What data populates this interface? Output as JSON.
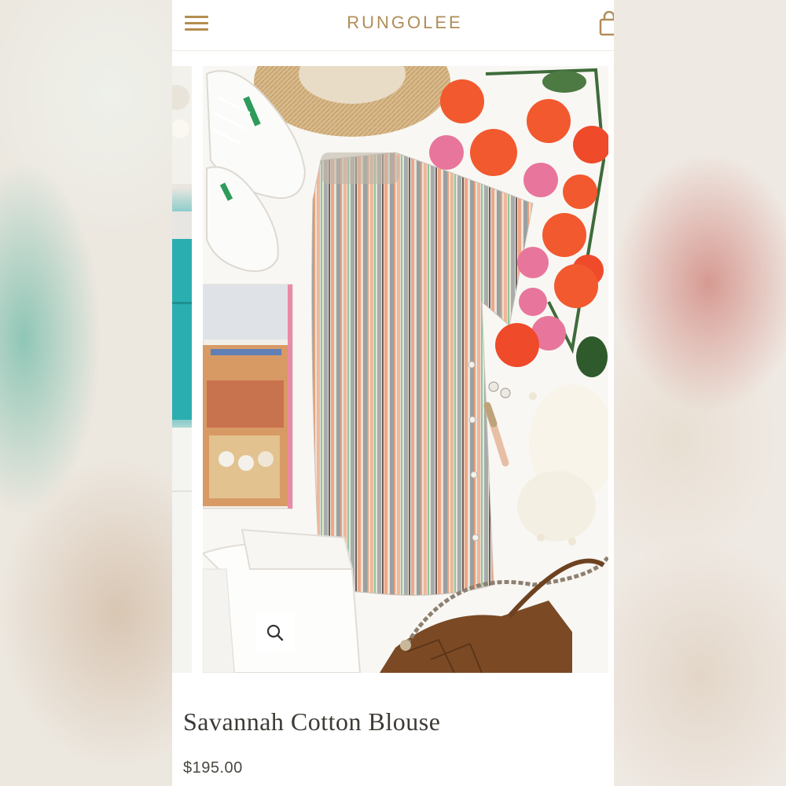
{
  "header": {
    "brand": "RUNGOLEE",
    "menu_icon": "hamburger-menu-icon",
    "cart_icon": "shopping-bag-icon"
  },
  "gallery": {
    "zoom_icon": "magnifier-icon",
    "main_image_subject": "Striped cotton blouse flat lay with roses, sneakers, straw hat, book, white jeans and brown chain handbag"
  },
  "product": {
    "title": "Savannah Cotton Blouse",
    "price": "$195.00"
  },
  "colors": {
    "brand_gold": "#b08d57",
    "title_text": "#3e3a35"
  }
}
